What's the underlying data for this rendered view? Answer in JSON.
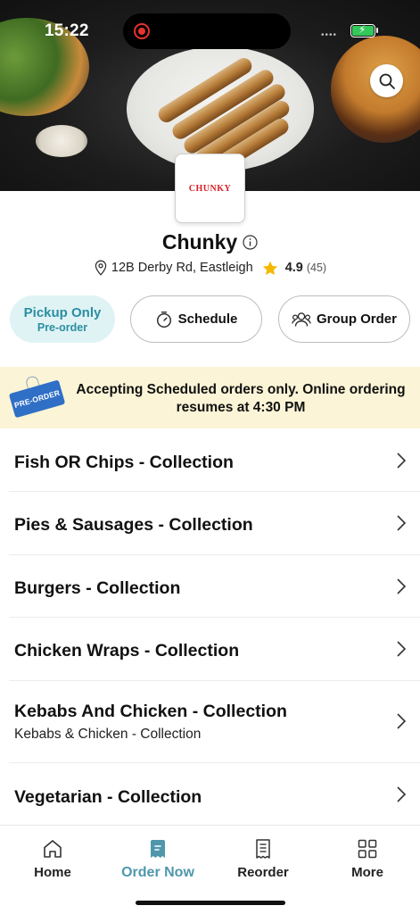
{
  "status_bar": {
    "time": "15:22"
  },
  "store": {
    "logo_text": "CHUNKY",
    "name": "Chunky",
    "address": "12B Derby Rd, Eastleigh",
    "rating": "4.9",
    "rating_count": "(45)"
  },
  "actions": {
    "pickup_label": "Pickup Only",
    "pickup_sublabel": "Pre-order",
    "schedule_label": "Schedule",
    "group_order_label": "Group Order"
  },
  "banner": {
    "tag_text": "PRE-ORDER",
    "message": "Accepting Scheduled orders only. Online ordering resumes at 4:30 PM"
  },
  "menu": {
    "categories": [
      {
        "title": "Fish OR Chips - Collection",
        "subtitle": ""
      },
      {
        "title": "Pies & Sausages - Collection",
        "subtitle": ""
      },
      {
        "title": "Burgers - Collection",
        "subtitle": ""
      },
      {
        "title": "Chicken Wraps - Collection",
        "subtitle": ""
      },
      {
        "title": "Kebabs And Chicken - Collection",
        "subtitle": "Kebabs & Chicken - Collection"
      },
      {
        "title": "Vegetarian - Collection",
        "subtitle": ""
      }
    ]
  },
  "bottom_nav": {
    "items": [
      {
        "label": "Home",
        "icon": "home-icon"
      },
      {
        "label": "Order Now",
        "icon": "order-now-icon",
        "active": true
      },
      {
        "label": "Reorder",
        "icon": "receipt-icon"
      },
      {
        "label": "More",
        "icon": "grid-icon"
      }
    ]
  },
  "colors": {
    "accent": "#4f97ad",
    "pickup_bg": "#dff3f5",
    "banner_bg": "#fbf4d6",
    "logo_red": "#d81f26",
    "star": "#f5b800"
  }
}
